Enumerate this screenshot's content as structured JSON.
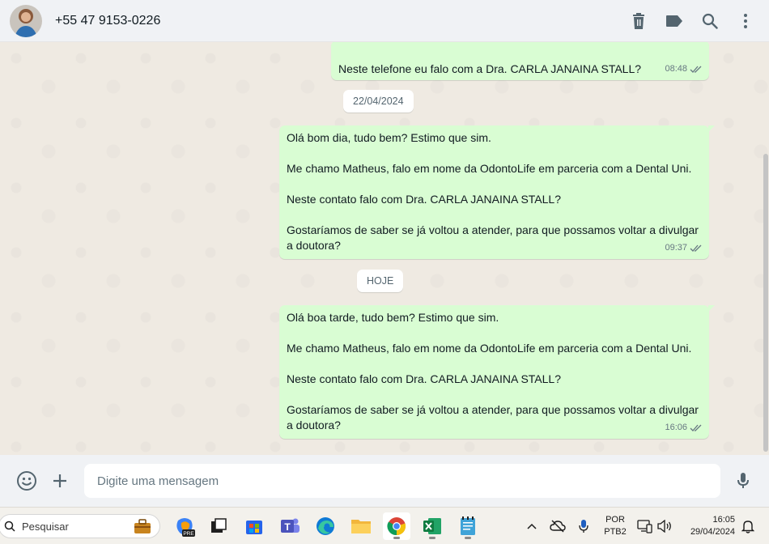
{
  "header": {
    "contact": "+55 47 9153-0226",
    "actions": [
      "trash-icon",
      "label-icon",
      "search-icon",
      "menu-icon"
    ]
  },
  "messages": [
    {
      "text": "Neste telefone eu falo com a Dra. CARLA JANAINA STALL?",
      "time": "08:48",
      "status": "read"
    },
    {
      "text": "Olá bom dia, tudo bem? Estimo que sim.\n\nMe chamo Matheus, falo em nome da OdontoLife em parceria com a Dental Uni.\n\nNeste contato falo com Dra. CARLA JANAINA STALL?\n\nGostaríamos de saber se já voltou a atender, para que possamos voltar a divulgar\na doutora?",
      "time": "09:37",
      "status": "read"
    },
    {
      "text": "Olá boa tarde, tudo bem? Estimo que sim.\n\nMe chamo Matheus, falo em nome da OdontoLife em parceria com a Dental Uni.\n\nNeste contato falo com Dra. CARLA JANAINA STALL?\n\nGostaríamos de saber se já voltou a atender, para que possamos voltar a divulgar\na doutora?",
      "time": "16:06",
      "status": "read"
    }
  ],
  "dates": {
    "first": "22/04/2024",
    "second": "HOJE"
  },
  "composer": {
    "placeholder": "Digite uma mensagem"
  },
  "taskbar": {
    "search_label": "Pesquisar",
    "copilot_badge": "PRE",
    "teams_letter": "T",
    "language": "POR",
    "keyboard": "PTB2",
    "time": "16:05",
    "date": "29/04/2024"
  },
  "colors": {
    "bubble_out": "#d9fdd3",
    "chat_bg": "#efeae2",
    "header_bg": "#f0f2f5",
    "read_ticks": "#667781"
  }
}
